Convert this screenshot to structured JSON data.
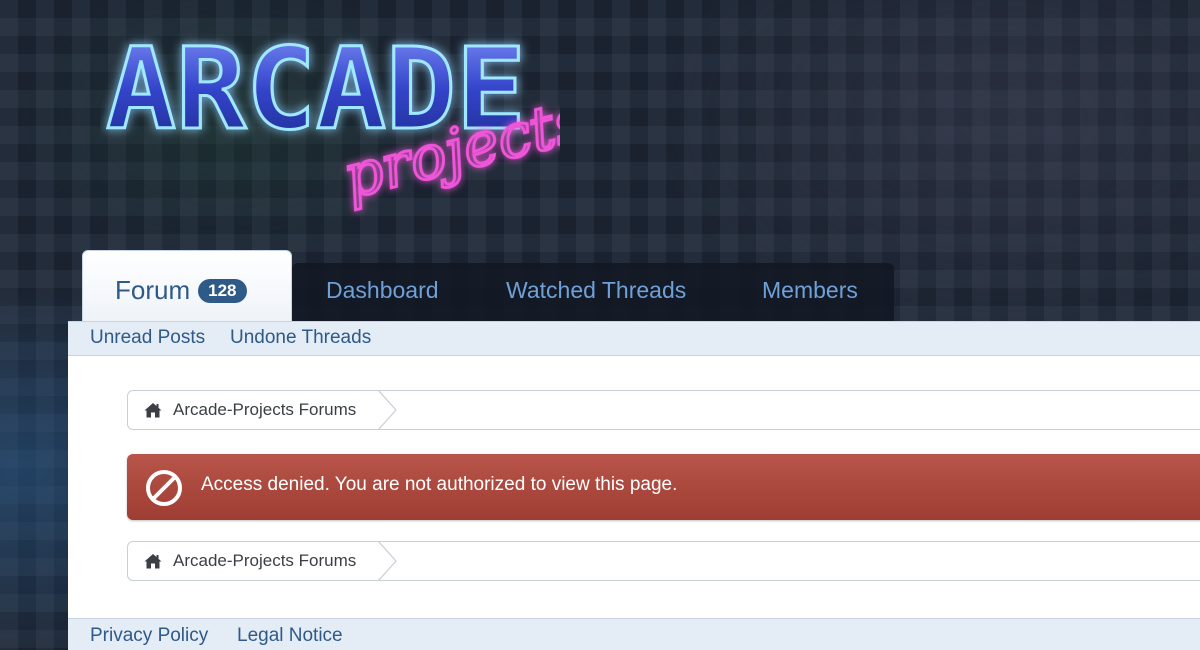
{
  "logo": {
    "main_text": "ARCADE",
    "sub_text": "projects",
    "colors": {
      "main": "#3f57d8",
      "glow": "#6fe0ff",
      "sub": "#e43fd0"
    }
  },
  "nav": {
    "tabs": [
      {
        "label": "Forum",
        "badge": "128",
        "active": true
      },
      {
        "label": "Dashboard"
      },
      {
        "label": "Watched Threads"
      },
      {
        "label": "Members"
      }
    ],
    "subnav": [
      "Unread Posts",
      "Undone Threads"
    ]
  },
  "breadcrumb": {
    "label": "Arcade-Projects Forums",
    "icon": "home-icon"
  },
  "error": {
    "message": "Access denied. You are not authorized to view this page.",
    "icon": "no-entry-icon",
    "color": "#ac4639"
  },
  "footer": {
    "links": [
      "Privacy Policy",
      "Legal Notice"
    ]
  },
  "colors": {
    "link": "#2f5a88",
    "tab_link": "#6fa0d8"
  }
}
